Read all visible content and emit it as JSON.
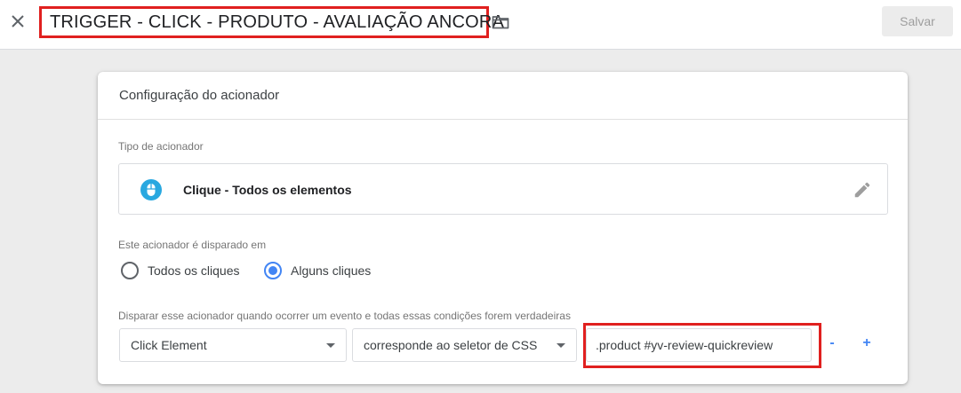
{
  "header": {
    "title": "TRIGGER - CLICK - PRODUTO - AVALIAÇÃO ANCORA",
    "save_label": "Salvar",
    "close_icon": "close-icon",
    "folder_icon": "folder-icon"
  },
  "card": {
    "title": "Configuração do acionador",
    "trigger_type_label": "Tipo de acionador",
    "trigger_type_value": "Clique - Todos os elementos",
    "trigger_type_icon": "mouse-icon",
    "edit_icon": "pencil-icon",
    "fires_on_label": "Este acionador é disparado em",
    "radio_options": [
      {
        "label": "Todos os cliques",
        "selected": false
      },
      {
        "label": "Alguns cliques",
        "selected": true
      }
    ],
    "condition_label": "Disparar esse acionador quando ocorrer um evento e todas essas condições forem verdadeiras",
    "condition": {
      "variable": "Click Element",
      "operator": "corresponde ao seletor de CSS",
      "value": ".product #yv-review-quickreview"
    },
    "remove_label": "-",
    "add_label": "+"
  },
  "colors": {
    "accent": "#4285f4",
    "highlight": "#e0201f",
    "icon_blue": "#29a8e0"
  }
}
